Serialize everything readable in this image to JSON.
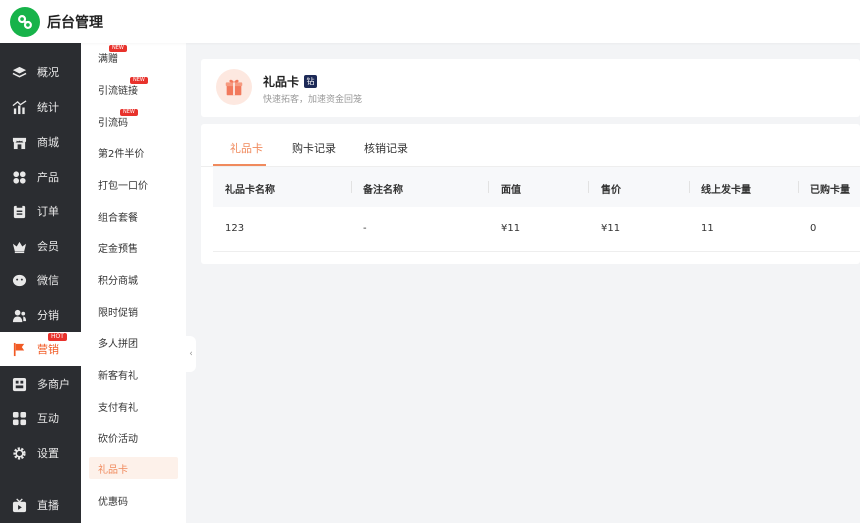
{
  "app": {
    "title": "后台管理"
  },
  "main_nav": [
    {
      "label": "概况",
      "icon": "layers-icon"
    },
    {
      "label": "统计",
      "icon": "stats-icon"
    },
    {
      "label": "商城",
      "icon": "store-icon"
    },
    {
      "label": "产品",
      "icon": "grid-icon"
    },
    {
      "label": "订单",
      "icon": "clipboard-icon"
    },
    {
      "label": "会员",
      "icon": "crown-icon"
    },
    {
      "label": "微信",
      "icon": "wechat-icon"
    },
    {
      "label": "分销",
      "icon": "users-icon"
    },
    {
      "label": "营销",
      "icon": "flag-icon",
      "badge": "HOT",
      "active": true
    },
    {
      "label": "多商户",
      "icon": "shop-icon"
    },
    {
      "label": "互动",
      "icon": "apps-icon"
    },
    {
      "label": "设置",
      "icon": "gear-icon"
    },
    {
      "label": "直播",
      "icon": "live-icon"
    }
  ],
  "sub_nav": [
    {
      "label": "满赠",
      "badge": "NEW"
    },
    {
      "label": "引流链接",
      "badge": "NEW"
    },
    {
      "label": "引流码",
      "badge": "NEW"
    },
    {
      "label": "第2件半价"
    },
    {
      "label": "打包一口价"
    },
    {
      "label": "组合套餐"
    },
    {
      "label": "定金预售"
    },
    {
      "label": "积分商城"
    },
    {
      "label": "限时促销"
    },
    {
      "label": "多人拼团"
    },
    {
      "label": "新客有礼"
    },
    {
      "label": "支付有礼"
    },
    {
      "label": "砍价活动"
    },
    {
      "label": "礼品卡",
      "active": true
    },
    {
      "label": "优惠码"
    }
  ],
  "header_card": {
    "title": "礼品卡",
    "badge": "钻",
    "subtitle": "快速拓客，加速资金回笼"
  },
  "tabs": [
    {
      "label": "礼品卡",
      "active": true
    },
    {
      "label": "购卡记录"
    },
    {
      "label": "核销记录"
    }
  ],
  "table": {
    "columns": [
      "礼品卡名称",
      "备注名称",
      "面值",
      "售价",
      "线上发卡量",
      "已购卡量"
    ],
    "rows": [
      [
        "123",
        "-",
        "¥11",
        "¥11",
        "11",
        "0"
      ]
    ]
  },
  "collapse_glyph": "‹",
  "colors": {
    "accent": "#f08a5d",
    "sidebar_bg": "#2b2d31",
    "logo_green": "#17b34a"
  }
}
